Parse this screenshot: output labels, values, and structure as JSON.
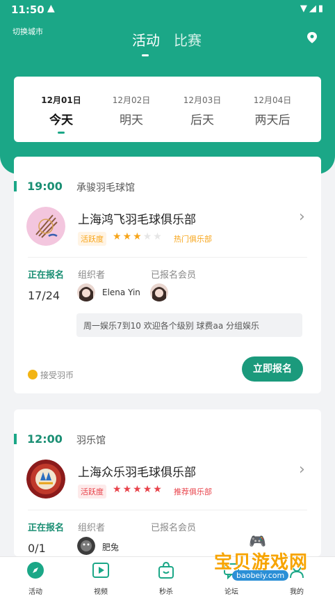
{
  "status_bar": {
    "time": "11:50"
  },
  "header": {
    "city_switch": "切换城市",
    "tabs": [
      {
        "label": "活动",
        "active": true
      },
      {
        "label": "比赛",
        "active": false
      }
    ]
  },
  "dates": [
    {
      "date": "12月01日",
      "label": "今天",
      "active": true
    },
    {
      "date": "12月02日",
      "label": "明天",
      "active": false
    },
    {
      "date": "12月03日",
      "label": "后天",
      "active": false
    },
    {
      "date": "12月04日",
      "label": "两天后",
      "active": false
    }
  ],
  "events": [
    {
      "time": "19:00",
      "venue": "承骏羽毛球馆",
      "club_name": "上海鸿飞羽毛球俱乐部",
      "activity_label": "活跃度",
      "stars": 3,
      "stars_total": 5,
      "club_tag": "热门俱乐部",
      "status": "正在报名",
      "count": "17/24",
      "organizer_label": "组织者",
      "members_label": "已报名会员",
      "organizer_name": "Elena Yin",
      "description": "周一娱乐7到10 欢迎各个级别 球费aa 分组娱乐",
      "coin_text": "接受羽币",
      "signup_label": "立即报名"
    },
    {
      "time": "12:00",
      "venue": "羽乐馆",
      "club_name": "上海众乐羽毛球俱乐部",
      "activity_label": "活跃度",
      "stars": 5,
      "stars_total": 5,
      "club_tag": "推荐俱乐部",
      "status": "正在报名",
      "count": "0/1",
      "organizer_label": "组织者",
      "members_label": "已报名会员",
      "organizer_name": "肥兔"
    }
  ],
  "bottom_nav": [
    {
      "label": "活动",
      "icon": "compass-icon"
    },
    {
      "label": "视频",
      "icon": "video-icon"
    },
    {
      "label": "秒杀",
      "icon": "shopping-bag-icon"
    },
    {
      "label": "论坛",
      "icon": "forum-icon"
    },
    {
      "label": "我的",
      "icon": "user-icon"
    }
  ],
  "watermark": {
    "title": "宝贝游戏网",
    "url": "baobeiy.com"
  },
  "colors": {
    "primary": "#1ba787",
    "primary_dark": "#1b8f74",
    "star_gold": "#f7a51a",
    "star_red": "#e8434b",
    "hot_tag": "#f7a51a",
    "recommend_tag": "#e8434b"
  }
}
